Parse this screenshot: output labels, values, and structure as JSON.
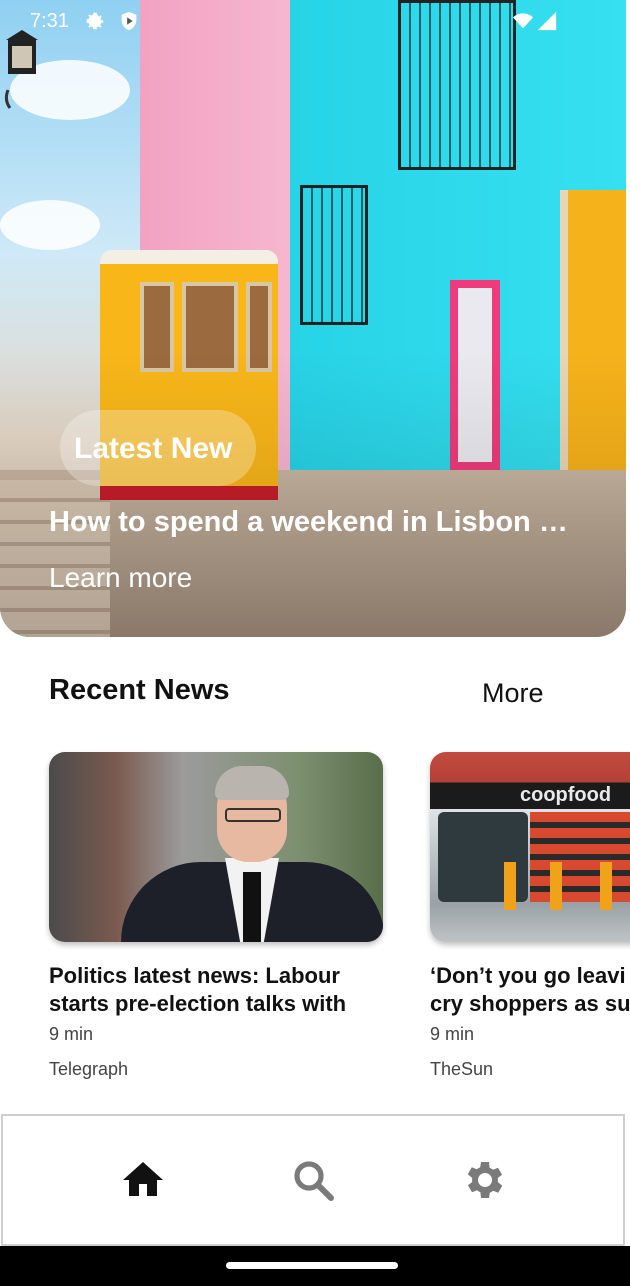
{
  "status_bar": {
    "time": "7:31",
    "icons": [
      "gear-icon",
      "shield-play-icon",
      "wifi-icon",
      "signal-icon"
    ]
  },
  "hero": {
    "badge": "Latest New",
    "headline": "How to spend a weekend in Lisbon – …",
    "cta": "Learn more"
  },
  "recent": {
    "title": "Recent News",
    "more_label": "More",
    "articles": [
      {
        "title": "Politics latest news: Labour starts pre-election talks with",
        "read_time": "9 min",
        "source": "Telegraph"
      },
      {
        "title": "‘Don’t you go leavi… cry shoppers as su…",
        "title_line1": "‘Don’t you go leavi",
        "title_line2": "cry shoppers as su",
        "read_time": "9 min",
        "source": "TheSun",
        "image_sign": "coopfood"
      }
    ]
  },
  "bottom_nav": {
    "items": [
      {
        "name": "home",
        "icon": "home-icon",
        "active": true
      },
      {
        "name": "search",
        "icon": "search-icon",
        "active": false
      },
      {
        "name": "settings",
        "icon": "gear-icon",
        "active": false
      }
    ]
  },
  "colors": {
    "active_icon": "#111111",
    "inactive_icon": "#7a7a7a",
    "accent_yellow": "#f8b619",
    "accent_cyan": "#27d3e6"
  }
}
